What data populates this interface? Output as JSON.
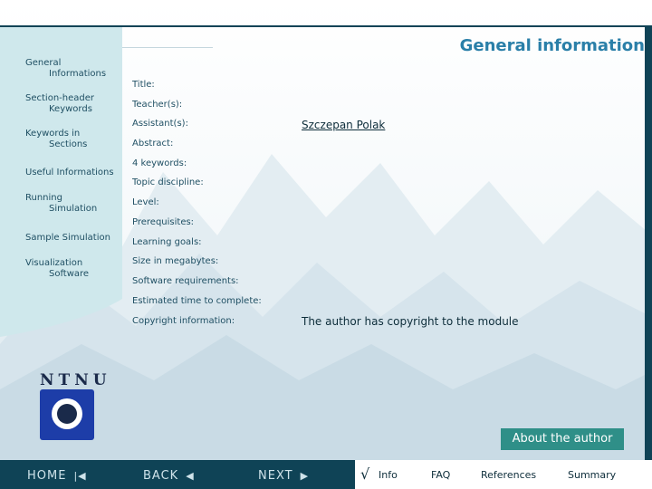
{
  "header": {
    "title": "General information"
  },
  "sidebar": {
    "items": [
      {
        "line1": "General",
        "line2": "Informations"
      },
      {
        "line1": "Section-header",
        "line2": "Keywords"
      },
      {
        "line1": "Keywords in",
        "line2": "Sections"
      },
      {
        "line1": "Useful Informations",
        "line2": ""
      },
      {
        "line1": "Running",
        "line2": "Simulation"
      },
      {
        "line1": "Sample Simulation",
        "line2": ""
      },
      {
        "line1": "Visualization",
        "line2": "Software"
      }
    ]
  },
  "fields": {
    "title": {
      "label": "Title:",
      "value": ""
    },
    "teachers": {
      "label": "Teacher(s):",
      "value": ""
    },
    "assistants": {
      "label": "Assistant(s):",
      "value": "Szczepan Polak"
    },
    "abstract": {
      "label": "Abstract:",
      "value": ""
    },
    "keywords": {
      "label": "4 keywords:",
      "value": ""
    },
    "topic": {
      "label": "Topic discipline:",
      "value": ""
    },
    "level": {
      "label": "Level:",
      "value": ""
    },
    "prerequisites": {
      "label": "Prerequisites:",
      "value": ""
    },
    "goals": {
      "label": "Learning goals:",
      "value": ""
    },
    "size": {
      "label": "Size in megabytes:",
      "value": ""
    },
    "software": {
      "label": "Software requirements:",
      "value": ""
    },
    "time": {
      "label": "Estimated time to complete:",
      "value": ""
    },
    "copyright": {
      "label": "Copyright information:",
      "value": "The author has copyright to the module"
    }
  },
  "logo": {
    "text": "NTNU"
  },
  "buttons": {
    "about": "About the author"
  },
  "nav": {
    "home": "HOME",
    "back": "BACK",
    "next": "NEXT"
  },
  "tabs": {
    "info": "Info",
    "faq": "FAQ",
    "references": "References",
    "summary": "Summary"
  },
  "colors": {
    "title": "#2a7fa8",
    "sidebar_bg": "#cfe8ec",
    "bottom_bar": "#0f4356",
    "about_button": "#2f8f88"
  }
}
